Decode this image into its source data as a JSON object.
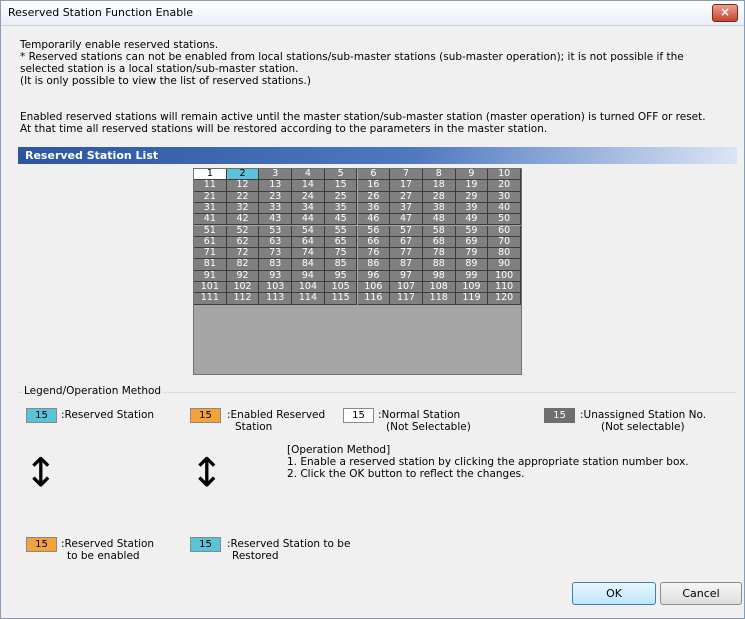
{
  "window": {
    "title": "Reserved Station Function Enable",
    "close_icon": "×"
  },
  "intro": {
    "line1": "Temporarily enable reserved stations.",
    "line2": "* Reserved stations can not be enabled from local stations/sub-master stations (sub-master operation); it is not possible if the",
    "line3": "selected station is a local station/sub-master station.",
    "line4": "(It is only possible to view the list of reserved stations.)",
    "line5": "Enabled reserved stations will remain active until the master station/sub-master station (master operation) is turned OFF or reset.",
    "line6": "At that time all reserved stations will be restored according to the parameters in the master station."
  },
  "list": {
    "header": "Reserved Station List",
    "stations": [
      "1",
      "2",
      "3",
      "4",
      "5",
      "6",
      "7",
      "8",
      "9",
      "10",
      "11",
      "12",
      "13",
      "14",
      "15",
      "16",
      "17",
      "18",
      "19",
      "20",
      "21",
      "22",
      "23",
      "24",
      "25",
      "26",
      "27",
      "28",
      "29",
      "30",
      "31",
      "32",
      "33",
      "34",
      "35",
      "36",
      "37",
      "38",
      "39",
      "40",
      "41",
      "42",
      "43",
      "44",
      "45",
      "46",
      "47",
      "48",
      "49",
      "50",
      "51",
      "52",
      "53",
      "54",
      "55",
      "56",
      "57",
      "58",
      "59",
      "60",
      "61",
      "62",
      "63",
      "64",
      "65",
      "66",
      "67",
      "68",
      "69",
      "70",
      "71",
      "72",
      "73",
      "74",
      "75",
      "76",
      "77",
      "78",
      "79",
      "80",
      "81",
      "82",
      "83",
      "84",
      "85",
      "86",
      "87",
      "88",
      "89",
      "90",
      "91",
      "92",
      "93",
      "94",
      "95",
      "96",
      "97",
      "98",
      "99",
      "100",
      "101",
      "102",
      "103",
      "104",
      "105",
      "106",
      "107",
      "108",
      "109",
      "110",
      "111",
      "112",
      "113",
      "114",
      "115",
      "116",
      "117",
      "118",
      "119",
      "120"
    ],
    "states": {
      "1": "normal",
      "2": "reserved"
    },
    "default_state": "unassigned"
  },
  "legend": {
    "title": "Legend/Operation Method",
    "sample_number": "15",
    "reserved_label": ":Reserved Station",
    "enabled_label_1": ":Enabled Reserved",
    "enabled_label_2": "Station",
    "normal_label_1": ":Normal Station",
    "normal_label_2": "(Not Selectable)",
    "unassigned_label_1": ":Unassigned Station No.",
    "unassigned_label_2": "(Not selectable)",
    "to_enable_label_1": ":Reserved Station",
    "to_enable_label_2": "to be enabled",
    "to_restore_label_1": ":Reserved Station to be",
    "to_restore_label_2": "Restored",
    "op_title": "[Operation Method]",
    "op_step1": "1. Enable a reserved station by clicking the appropriate station number box.",
    "op_step2": "2. Click the OK button to reflect the changes.",
    "arrow_glyph": "↕",
    "colors": {
      "reserved": "#5bc3d9",
      "enabled": "#f4a23c",
      "normal": "#ffffff",
      "unassigned": "#6e6e6e"
    }
  },
  "buttons": {
    "ok": "OK",
    "cancel": "Cancel"
  }
}
